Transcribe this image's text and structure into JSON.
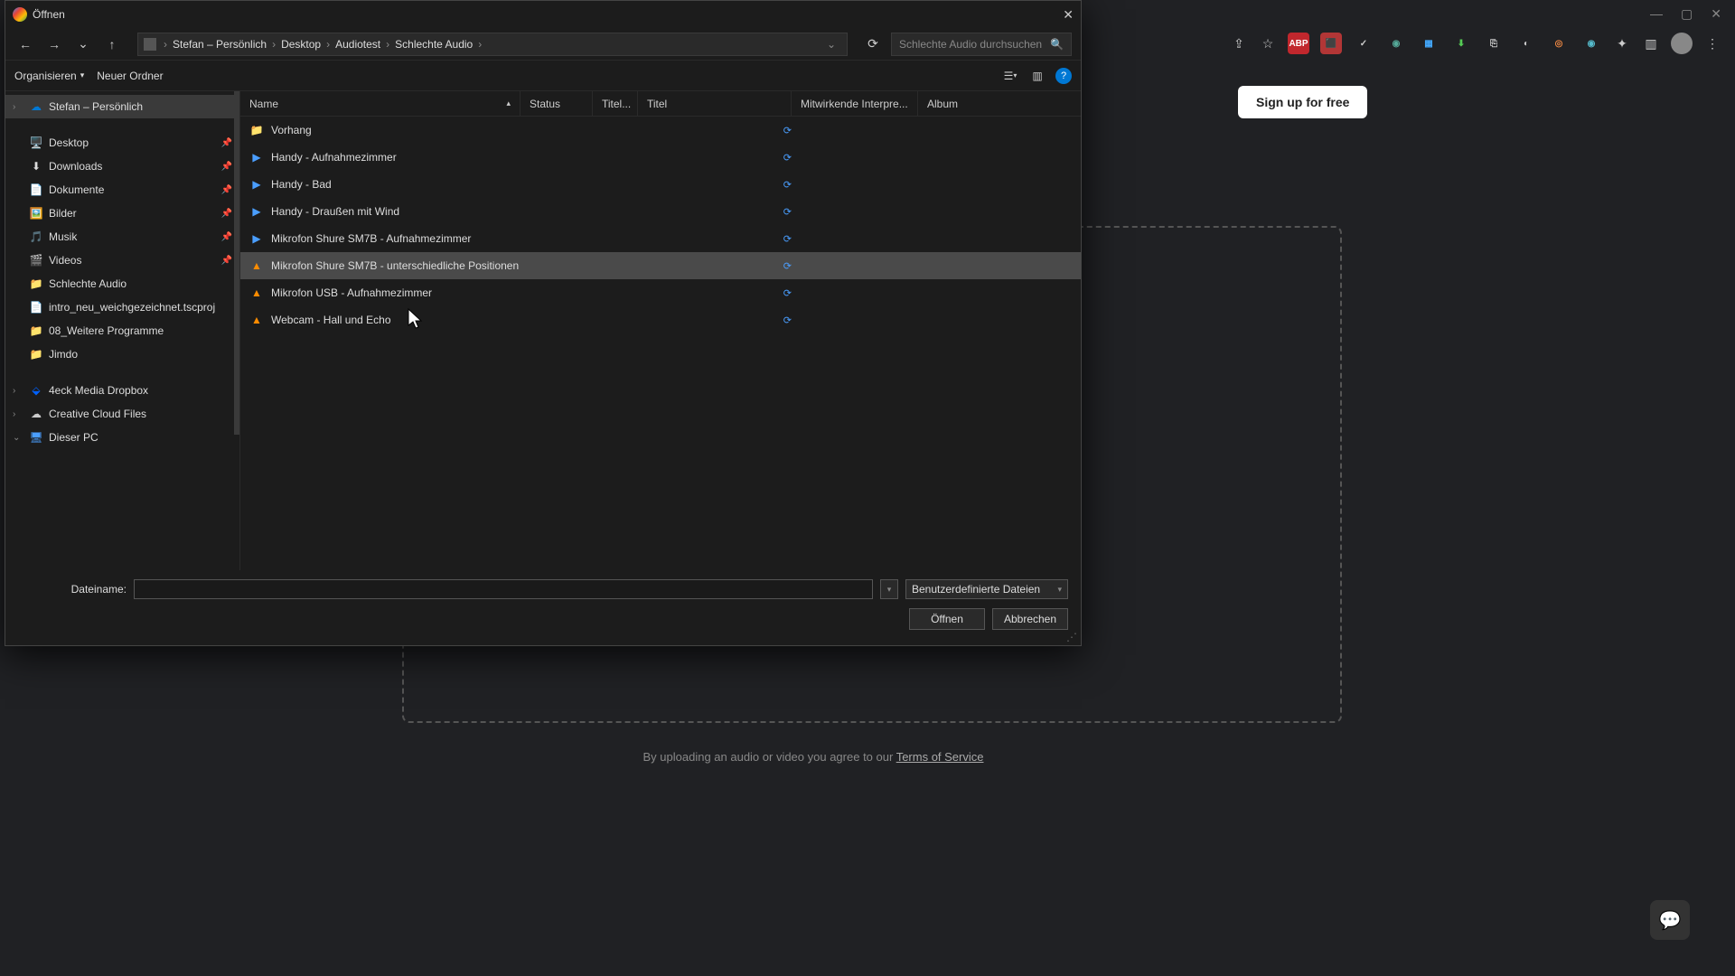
{
  "browser": {
    "signup": "Sign up for free",
    "terms_prefix": "By uploading an audio or video you agree to our ",
    "terms_link": "Terms of Service"
  },
  "dialog": {
    "title": "Öffnen",
    "breadcrumb": [
      "Stefan – Persönlich",
      "Desktop",
      "Audiotest",
      "Schlechte Audio"
    ],
    "search_placeholder": "Schlechte Audio durchsuchen",
    "organize": "Organisieren",
    "new_folder": "Neuer Ordner",
    "columns": {
      "name": "Name",
      "status": "Status",
      "tracknum": "Titel...",
      "title": "Titel",
      "artist": "Mitwirkende Interpre...",
      "album": "Album"
    },
    "sidebar": {
      "root": "Stefan – Persönlich",
      "quick": [
        {
          "label": "Desktop",
          "icon": "🖥️",
          "pin": true
        },
        {
          "label": "Downloads",
          "icon": "⬇",
          "pin": true
        },
        {
          "label": "Dokumente",
          "icon": "📄",
          "pin": true
        },
        {
          "label": "Bilder",
          "icon": "🖼️",
          "pin": true
        },
        {
          "label": "Musik",
          "icon": "🎵",
          "pin": true
        },
        {
          "label": "Videos",
          "icon": "🎬",
          "pin": true
        },
        {
          "label": "Schlechte Audio",
          "icon": "📁",
          "pin": false
        },
        {
          "label": "intro_neu_weichgezeichnet.tscproj",
          "icon": "📄",
          "pin": false
        },
        {
          "label": "08_Weitere Programme",
          "icon": "📁",
          "pin": false
        },
        {
          "label": "Jimdo",
          "icon": "📁",
          "pin": false
        }
      ],
      "dropbox": "4eck Media Dropbox",
      "cc": "Creative Cloud Files",
      "thispc": "Dieser PC"
    },
    "files": [
      {
        "name": "Vorhang",
        "type": "folder"
      },
      {
        "name": "Handy - Aufnahmezimmer",
        "type": "video"
      },
      {
        "name": "Handy - Bad",
        "type": "video"
      },
      {
        "name": "Handy - Draußen mit Wind",
        "type": "video"
      },
      {
        "name": "Mikrofon Shure SM7B - Aufnahmezimmer",
        "type": "video"
      },
      {
        "name": "Mikrofon Shure SM7B - unterschiedliche Positionen",
        "type": "vlc",
        "selected": true
      },
      {
        "name": "Mikrofon USB - Aufnahmezimmer",
        "type": "vlc"
      },
      {
        "name": "Webcam - Hall und Echo",
        "type": "vlc"
      }
    ],
    "filename_label": "Dateiname:",
    "filename_value": "",
    "filter": "Benutzerdefinierte Dateien",
    "open_btn": "Öffnen",
    "cancel_btn": "Abbrechen"
  }
}
